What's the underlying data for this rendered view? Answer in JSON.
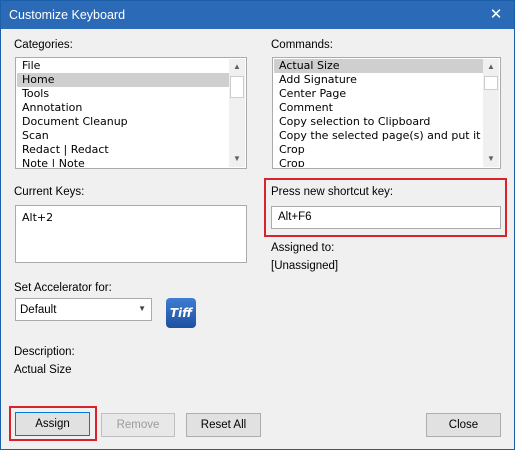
{
  "window": {
    "title": "Customize Keyboard",
    "close_glyph": "✕"
  },
  "categories": {
    "label": "Categories:",
    "items": [
      "File",
      "Home",
      "Tools",
      "Annotation",
      "Document Cleanup",
      "Scan",
      "Redact | Redact",
      "Note | Note"
    ],
    "selected_index": 1
  },
  "commands": {
    "label": "Commands:",
    "items": [
      "Actual Size",
      "Add Signature",
      "Center Page",
      "Comment",
      "Copy selection to Clipboard",
      "Copy the selected page(s) and put it or",
      "Crop",
      "Crop"
    ],
    "selected_index": 0
  },
  "current_keys": {
    "label": "Current Keys:",
    "items": [
      "Alt+2"
    ]
  },
  "shortcut": {
    "label": "Press new shortcut key:",
    "value": "Alt+F6"
  },
  "assigned": {
    "label": "Assigned to:",
    "value": "[Unassigned]"
  },
  "accelerator": {
    "label": "Set Accelerator for:",
    "value": "Default"
  },
  "tiff_icon": {
    "text": "Tiff"
  },
  "description": {
    "label": "Description:",
    "value": "Actual Size"
  },
  "buttons": {
    "assign": "Assign",
    "remove": "Remove",
    "reset_all": "Reset All",
    "close": "Close"
  },
  "colors": {
    "titlebar": "#2b6ab7",
    "highlight": "#d9232b",
    "selection": "#cfcfcf"
  }
}
